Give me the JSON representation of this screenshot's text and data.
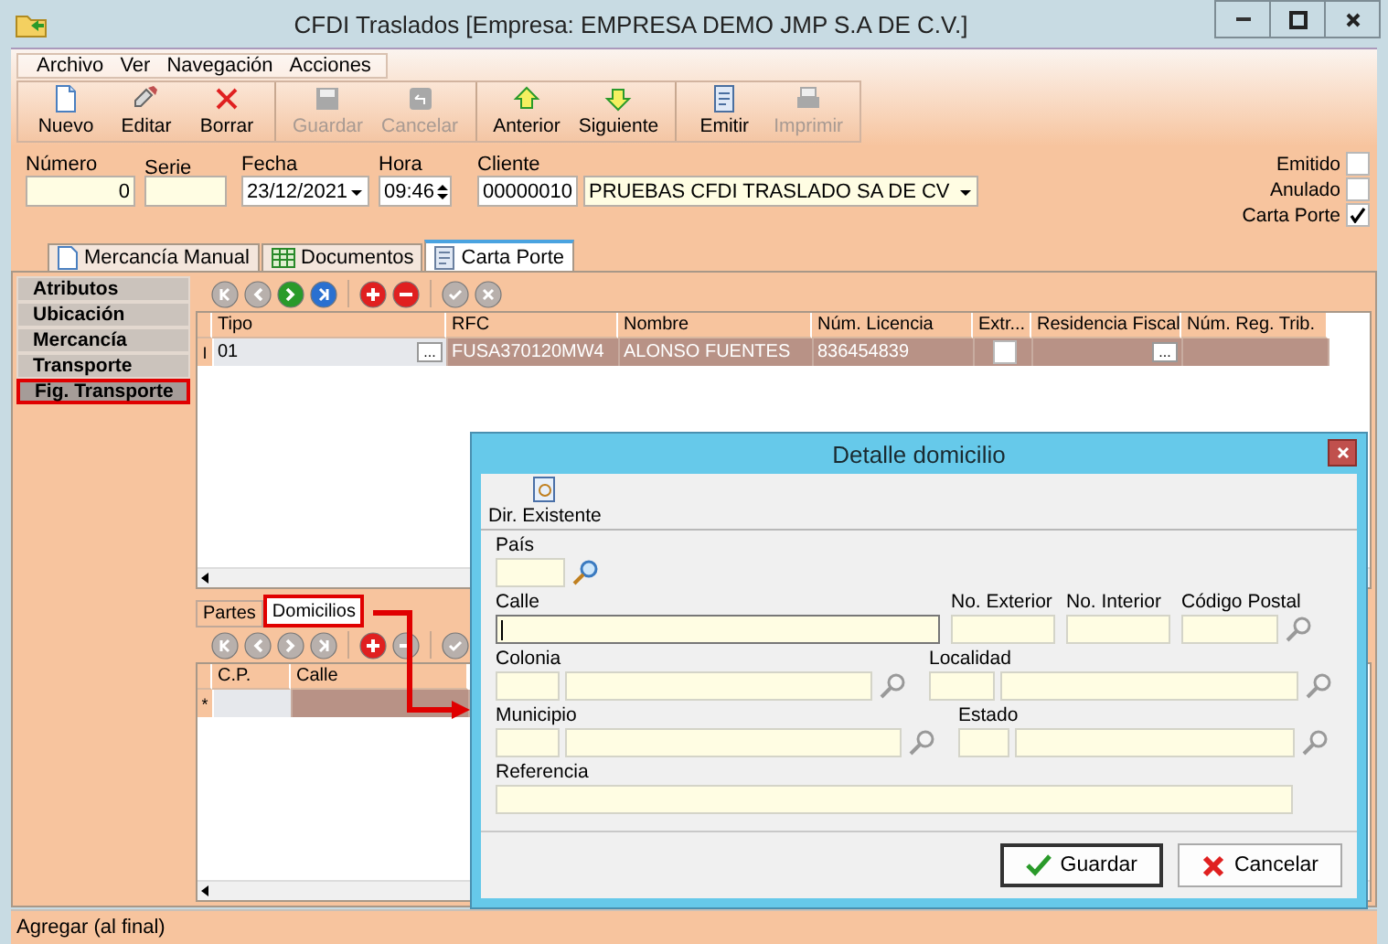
{
  "window": {
    "title": "CFDI Traslados [Empresa: EMPRESA DEMO JMP S.A DE C.V.]"
  },
  "menu": [
    "Archivo",
    "Ver",
    "Navegación",
    "Acciones"
  ],
  "toolbar": [
    [
      {
        "label": "Nuevo",
        "disabled": false
      },
      {
        "label": "Editar",
        "disabled": false
      },
      {
        "label": "Borrar",
        "disabled": false
      }
    ],
    [
      {
        "label": "Guardar",
        "disabled": true
      },
      {
        "label": "Cancelar",
        "disabled": true
      }
    ],
    [
      {
        "label": "Anterior",
        "disabled": false
      },
      {
        "label": "Siguiente",
        "disabled": false
      }
    ],
    [
      {
        "label": "Emitir",
        "disabled": false
      },
      {
        "label": "Imprimir",
        "disabled": true
      }
    ]
  ],
  "header": {
    "numero": {
      "label": "Número",
      "value": "0"
    },
    "serie": {
      "label": "Serie"
    },
    "fecha": {
      "label": "Fecha",
      "value": "23/12/2021"
    },
    "hora": {
      "label": "Hora",
      "value": "09:46"
    },
    "cliente": {
      "label": "Cliente",
      "code": "00000010",
      "name": "PRUEBAS CFDI TRASLADO SA DE CV"
    }
  },
  "flags": [
    {
      "label": "Emitido",
      "checked": false
    },
    {
      "label": "Anulado",
      "checked": false
    },
    {
      "label": "Carta Porte",
      "checked": true
    }
  ],
  "tabs": [
    {
      "label": "Mercancía Manual",
      "selected": false
    },
    {
      "label": "Documentos",
      "selected": false
    },
    {
      "label": "Carta Porte",
      "selected": true
    }
  ],
  "sections": [
    {
      "label": "Atributos",
      "selected": false,
      "highlighted": false
    },
    {
      "label": "Ubicación",
      "selected": false,
      "highlighted": false
    },
    {
      "label": "Mercancía",
      "selected": false,
      "highlighted": false
    },
    {
      "label": "Transporte",
      "selected": false,
      "highlighted": false
    },
    {
      "label": "Fig. Transporte",
      "selected": true,
      "highlighted": true
    }
  ],
  "figures_grid": {
    "navigator": [
      {
        "kind": "first",
        "disabled": true
      },
      {
        "kind": "prev",
        "disabled": true
      },
      {
        "kind": "next",
        "disabled": false
      },
      {
        "kind": "last",
        "disabled": false
      },
      {
        "kind": "add",
        "disabled": false
      },
      {
        "kind": "delete",
        "disabled": false
      },
      {
        "kind": "post",
        "disabled": true
      },
      {
        "kind": "cancel",
        "disabled": true
      }
    ],
    "columns": [
      "Tipo",
      "RFC",
      "Nombre",
      "Núm. Licencia",
      "Extr...",
      "Residencia Fiscal",
      "Núm. Reg. Trib."
    ],
    "rows": [
      {
        "indicator": "I",
        "cells": [
          {
            "kind": "lookup",
            "value": "01",
            "button": "..."
          },
          {
            "kind": "text",
            "value": "FUSA370120MW4"
          },
          {
            "kind": "text",
            "value": "ALONSO FUENTES"
          },
          {
            "kind": "text",
            "value": "836454839"
          },
          {
            "kind": "check",
            "checked": false
          },
          {
            "kind": "lookup",
            "button": "..."
          },
          {
            "kind": "empty"
          }
        ]
      }
    ]
  },
  "sub_tabs": [
    {
      "label": "Partes",
      "selected": false,
      "highlighted": false
    },
    {
      "label": "Domicilios",
      "selected": true,
      "highlighted": true
    }
  ],
  "addresses_grid": {
    "navigator": [
      {
        "kind": "first",
        "disabled": true
      },
      {
        "kind": "prev",
        "disabled": true
      },
      {
        "kind": "next",
        "disabled": true
      },
      {
        "kind": "last",
        "disabled": true
      },
      {
        "kind": "add",
        "disabled": false
      },
      {
        "kind": "delete",
        "disabled": true
      },
      {
        "kind": "post",
        "disabled": true
      }
    ],
    "columns": [
      "C.P.",
      "Calle"
    ],
    "rows": [
      {
        "indicator": "*"
      }
    ]
  },
  "dialog": {
    "title": "Detalle domicilio",
    "toolbar_button": "Dir. Existente",
    "rows": [
      [
        {
          "label": "País",
          "kind": "code",
          "lookup_disabled": false
        }
      ],
      [
        {
          "label": "Calle",
          "kind": "text",
          "focused": true
        },
        {
          "label": "No. Exterior",
          "kind": "text",
          "focused": false
        },
        {
          "label": "No. Interior",
          "kind": "text",
          "focused": false
        },
        {
          "label": "Código Postal",
          "kind": "code",
          "lookup_disabled": true
        }
      ],
      [
        {
          "label": "Colonia",
          "kind": "coded",
          "lookup_disabled": true
        },
        {
          "label": "Localidad",
          "kind": "coded",
          "lookup_disabled": true
        }
      ],
      [
        {
          "label": "Municipio",
          "kind": "coded",
          "lookup_disabled": true
        },
        {
          "label": "Estado",
          "kind": "coded",
          "lookup_disabled": true
        }
      ],
      [
        {
          "label": "Referencia",
          "kind": "text",
          "focused": false
        }
      ]
    ],
    "buttons": [
      {
        "label": "Guardar",
        "kind": "save",
        "default": true
      },
      {
        "label": "Cancelar",
        "kind": "cancel",
        "default": false
      }
    ]
  },
  "status_bar": "Agregar (al final)"
}
